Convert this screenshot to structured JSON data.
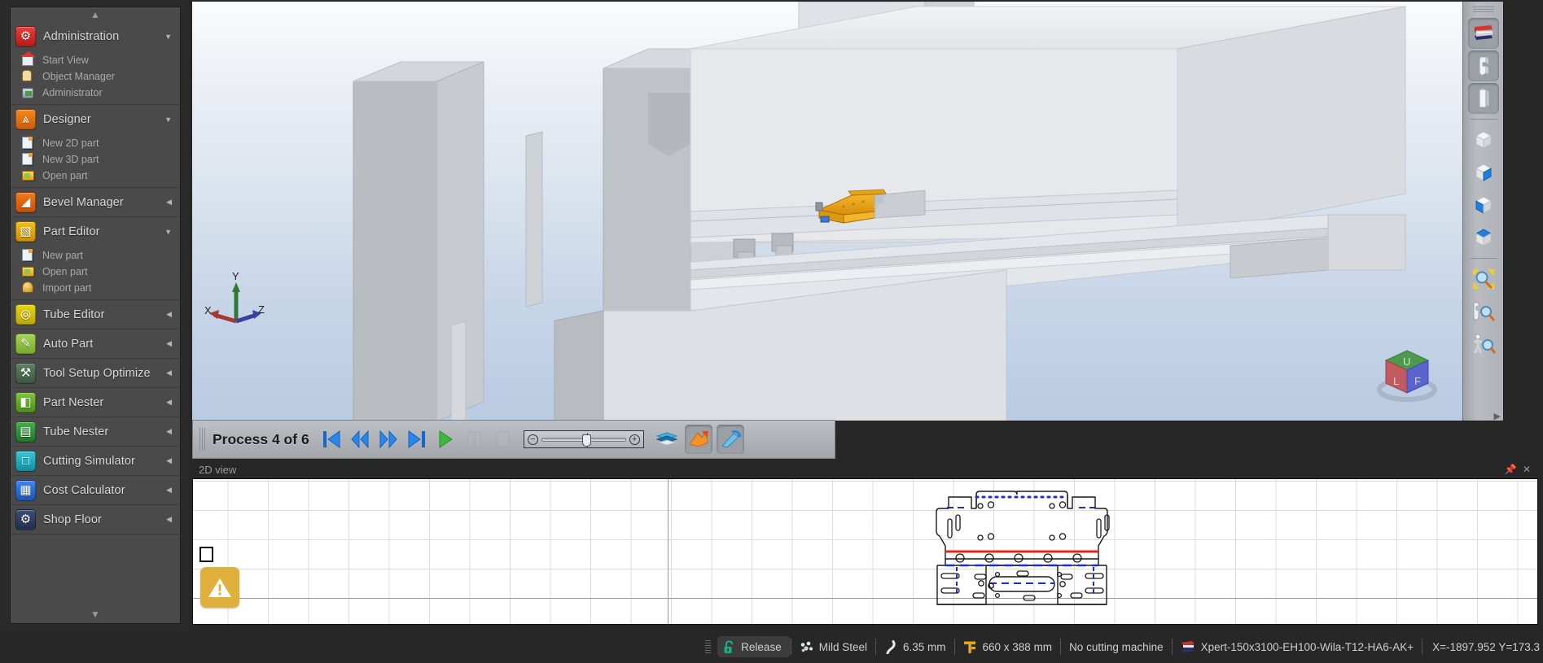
{
  "sidebar": {
    "scroll_up_icon": "chevron-up-icon",
    "scroll_down_icon": "chevron-down-icon",
    "groups": [
      {
        "label": "Administration",
        "icon": "gear-icon",
        "arrow": "▼",
        "expanded": true,
        "items": [
          {
            "label": "Start View",
            "icon": "house-icon"
          },
          {
            "label": "Object Manager",
            "icon": "user-icon"
          },
          {
            "label": "Administrator",
            "icon": "database-icon"
          }
        ]
      },
      {
        "label": "Designer",
        "icon": "designer-icon",
        "arrow": "▼",
        "expanded": true,
        "items": [
          {
            "label": "New 2D part",
            "icon": "new-page-icon"
          },
          {
            "label": "New 3D part",
            "icon": "new-page-icon"
          },
          {
            "label": "Open part",
            "icon": "open-folder-icon"
          }
        ]
      },
      {
        "label": "Bevel Manager",
        "icon": "bevel-icon",
        "arrow": "◀",
        "expanded": false,
        "items": []
      },
      {
        "label": "Part Editor",
        "icon": "part-editor-icon",
        "arrow": "▼",
        "expanded": true,
        "items": [
          {
            "label": "New part",
            "icon": "new-page-icon"
          },
          {
            "label": "Open part",
            "icon": "open-folder-icon"
          },
          {
            "label": "Import part",
            "icon": "import-icon"
          }
        ]
      },
      {
        "label": "Tube Editor",
        "icon": "tube-editor-icon",
        "arrow": "◀",
        "expanded": false,
        "items": []
      },
      {
        "label": "Auto Part",
        "icon": "auto-part-icon",
        "arrow": "◀",
        "expanded": false,
        "items": []
      },
      {
        "label": "Tool Setup Optimize",
        "icon": "tool-setup-icon",
        "arrow": "◀",
        "expanded": false,
        "items": []
      },
      {
        "label": "Part Nester",
        "icon": "part-nester-icon",
        "arrow": "◀",
        "expanded": false,
        "items": []
      },
      {
        "label": "Tube Nester",
        "icon": "tube-nester-icon",
        "arrow": "◀",
        "expanded": false,
        "items": []
      },
      {
        "label": "Cutting Simulator",
        "icon": "cutting-simulator-icon",
        "arrow": "◀",
        "expanded": false,
        "items": []
      },
      {
        "label": "Cost Calculator",
        "icon": "cost-calculator-icon",
        "arrow": "◀",
        "expanded": false,
        "items": []
      },
      {
        "label": "Shop Floor",
        "icon": "shop-floor-icon",
        "arrow": "◀",
        "expanded": false,
        "items": []
      }
    ]
  },
  "viewport": {
    "axis_gizmo": {
      "x_label": "X",
      "y_label": "Y",
      "z_label": "Z",
      "x_color": "#a03a33",
      "y_color": "#2f7a32",
      "z_color": "#3a40a0"
    },
    "view_cube": {
      "top_face": "U",
      "left_face": "L",
      "front_face": "F",
      "top_color": "#4d9a4d",
      "left_color": "#c25a60",
      "front_color": "#5b63cc"
    },
    "background_top": "#fafbfc",
    "background_bottom": "#b9cbe2",
    "part_color": "#e8a21c"
  },
  "right_toolbar": {
    "buttons": [
      {
        "name": "press-brake-icon",
        "pressed": true
      },
      {
        "name": "punch-tool-icon",
        "pressed": true
      },
      {
        "name": "die-tool-icon",
        "pressed": true
      },
      {
        "name": "view-iso-cube-icon",
        "pressed": false
      },
      {
        "name": "view-right-cube-icon",
        "pressed": false
      },
      {
        "name": "view-front-cube-icon",
        "pressed": false
      },
      {
        "name": "view-top-cube-icon",
        "pressed": false
      },
      {
        "name": "zoom-fit-icon",
        "pressed": false
      },
      {
        "name": "zoom-window-icon",
        "pressed": false
      },
      {
        "name": "zoom-dynamic-icon",
        "pressed": false
      }
    ],
    "collapse_icon": "chevron-right-icon"
  },
  "process_toolbar": {
    "label": "Process 4 of 6",
    "current_step": 4,
    "total_steps": 6,
    "buttons": [
      {
        "name": "first-process-button",
        "icon": "skip-back-icon",
        "enabled": true
      },
      {
        "name": "previous-process-button",
        "icon": "step-back-icon",
        "enabled": true
      },
      {
        "name": "next-process-button",
        "icon": "step-fwd-icon",
        "enabled": true
      },
      {
        "name": "last-process-button",
        "icon": "skip-fwd-icon",
        "enabled": true
      },
      {
        "name": "play-button",
        "icon": "play-icon",
        "enabled": true
      },
      {
        "name": "pause-button",
        "icon": "pause-icon",
        "enabled": false
      },
      {
        "name": "stop-button",
        "icon": "stop-icon",
        "enabled": false
      }
    ],
    "speed_slider": {
      "minus": "−",
      "plus": "+",
      "value_percent": 48
    },
    "toggles": [
      {
        "name": "collision-view-button",
        "icon": "sheet-stack-icon",
        "active": false
      },
      {
        "name": "bend-animation-button",
        "icon": "orange-arrow-icon",
        "active": true
      },
      {
        "name": "tool-setup-button",
        "icon": "blue-tool-icon",
        "active": true
      }
    ]
  },
  "panel_2d": {
    "title": "2D view",
    "pin_icon": "pin-icon",
    "close_icon": "close-icon",
    "warning_icon": "warning-triangle-icon",
    "grid_visible": true,
    "drawing": {
      "outline_color": "#1a1a1a",
      "bend_line_red": "#e8231a",
      "bend_line_blue": "#1a2ed8"
    }
  },
  "statusbar": {
    "cells": [
      {
        "name": "release-status",
        "icon": "unlock-icon",
        "label": "Release",
        "icon_color": "#1dab8c",
        "pill": true
      },
      {
        "name": "material-status",
        "icon": "material-icon",
        "label": "Mild Steel",
        "icon_color": "#dcdcdc",
        "pill": false
      },
      {
        "name": "thickness-status",
        "icon": "thickness-icon",
        "label": "6.35 mm",
        "icon_color": "#cfcfcf",
        "pill": false
      },
      {
        "name": "dimension-status",
        "icon": "ruler-icon",
        "label": "660 x 388 mm",
        "icon_color": "#e0a81c",
        "pill": false
      },
      {
        "name": "machine-status",
        "icon": "none",
        "label": "No cutting machine",
        "icon_color": "#cfcfcf",
        "pill": false
      },
      {
        "name": "press-status",
        "icon": "press-brake-small-icon",
        "label": "Xpert-150x3100-EH100-Wila-T12-HA6-AK+",
        "icon_color": "#c03a30",
        "pill": false
      }
    ],
    "coordinates": "X=-1897.952  Y=173.3"
  }
}
